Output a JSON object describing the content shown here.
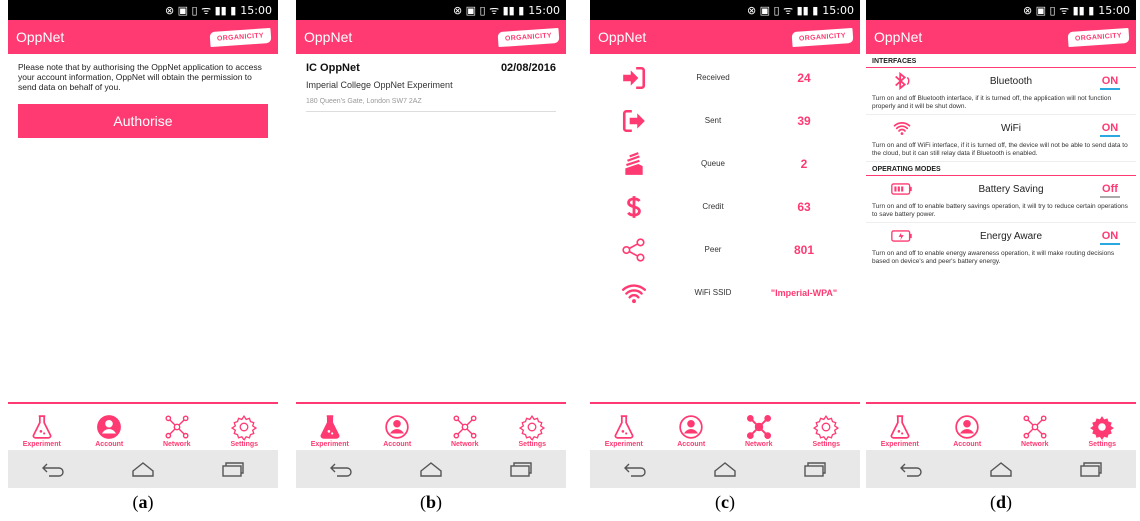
{
  "status": {
    "time": "15:00"
  },
  "app": {
    "title": "OppNet",
    "logo_text": "ORGANICITY"
  },
  "tabs": {
    "experiment": "Experiment",
    "account": "Account",
    "network": "Network",
    "settings": "Settings"
  },
  "panel_a": {
    "caption": "a",
    "notice": "Please note that by authorising the OppNet application to access your account information, OppNet will obtain the permission to send data on behalf of you.",
    "authorise_label": "Authorise",
    "active_tab": "account"
  },
  "panel_b": {
    "caption": "b",
    "name": "IC OppNet",
    "date": "02/08/2016",
    "experiment": "Imperial College OppNet Experiment",
    "address": "180 Queen's Gate, London SW7 2AZ",
    "active_tab": "experiment"
  },
  "panel_c": {
    "caption": "c",
    "rows": [
      {
        "label": "Received",
        "value": "24",
        "icon": "received-icon"
      },
      {
        "label": "Sent",
        "value": "39",
        "icon": "sent-icon"
      },
      {
        "label": "Queue",
        "value": "2",
        "icon": "queue-icon"
      },
      {
        "label": "Credit",
        "value": "63",
        "icon": "credit-icon"
      },
      {
        "label": "Peer",
        "value": "801",
        "icon": "peer-icon"
      },
      {
        "label": "WiFi SSID",
        "value": "\"Imperial-WPA\"",
        "icon": "wifi-icon"
      }
    ],
    "active_tab": "network"
  },
  "panel_d": {
    "caption": "d",
    "interfaces_heading": "INTERFACES",
    "modes_heading": "OPERATING MODES",
    "bluetooth": {
      "label": "Bluetooth",
      "value": "ON",
      "desc": "Turn on and off Bluetooth interface, if it is turned off, the application will not function properly and it will be shut down."
    },
    "wifi": {
      "label": "WiFi",
      "value": "ON",
      "desc": "Turn on and off WiFi interface, if it is turned off, the device will not be able to send data to the cloud, but it can still relay data if Bluetooth is enabled."
    },
    "battery": {
      "label": "Battery Saving",
      "value": "Off",
      "desc": "Turn on and off to enable battery savings operation, it will try to reduce certain operations to save battery power."
    },
    "energy": {
      "label": "Energy Aware",
      "value": "ON",
      "desc": "Turn on and off to enable energy awareness operation, it will make routing decisions based on device's and peer's battery energy."
    },
    "active_tab": "settings"
  },
  "colors": {
    "accent": "#ff3a72",
    "toggle_on": "#2aa9e0"
  }
}
